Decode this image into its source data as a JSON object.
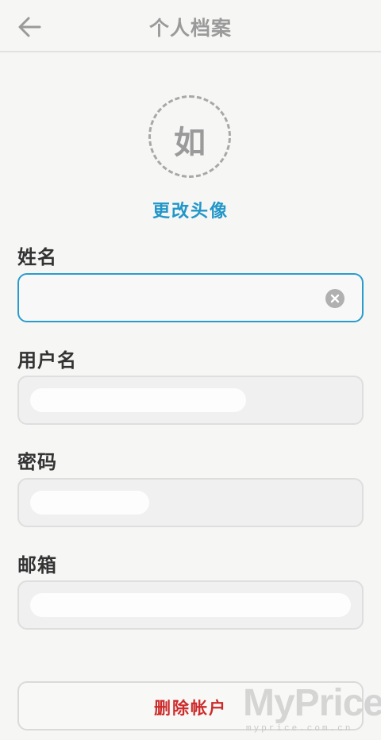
{
  "header": {
    "title": "个人档案",
    "back_icon": "arrow-left-icon"
  },
  "avatar": {
    "initial": "如",
    "change_label": "更改头像"
  },
  "form": {
    "name": {
      "label": "姓名",
      "value": "",
      "clear_icon": "clear-circle-icon"
    },
    "username": {
      "label": "用户名",
      "value": ""
    },
    "password": {
      "label": "密码",
      "value": ""
    },
    "email": {
      "label": "邮箱",
      "value": ""
    }
  },
  "actions": {
    "delete_label": "删除帐户"
  },
  "watermark": {
    "brand": "MyPrice",
    "domain": "myprice.com.cn"
  },
  "colors": {
    "accent": "#2196c9",
    "danger": "#cc2a2a",
    "muted": "#9a9a9a"
  }
}
